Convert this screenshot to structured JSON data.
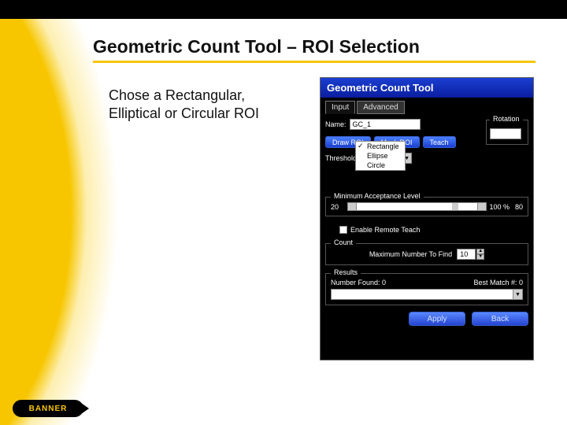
{
  "slide": {
    "title": "Geometric Count Tool – ROI Selection",
    "body": "Chose a Rectangular, Elliptical or Circular ROI"
  },
  "logo": "BANNER",
  "panel": {
    "title": "Geometric Count Tool",
    "tabs": {
      "input": "Input",
      "advanced": "Advanced"
    },
    "name_label": "Name:",
    "name_value": "GC_1",
    "rotation_label": "Rotation",
    "draw_roi": "Draw ROI",
    "mask_roi": "Mask ROI",
    "teach_roi": "Teach",
    "threshold_label": "Threshold",
    "dropdown": {
      "rect": "Rectangle",
      "ellipse": "Ellipse",
      "circle": "Circle"
    },
    "acc_group": "Minimum Acceptance Level",
    "acc_low": "20",
    "acc_pct": "100 %",
    "acc_val": "80",
    "remote_teach": "Enable Remote Teach",
    "count_group": "Count",
    "max_find_label": "Maximum Number To Find",
    "max_find_value": "10",
    "results_group": "Results",
    "number_found": "Number Found:  0",
    "best_match": "Best Match #:  0",
    "apply": "Apply",
    "back": "Back"
  }
}
